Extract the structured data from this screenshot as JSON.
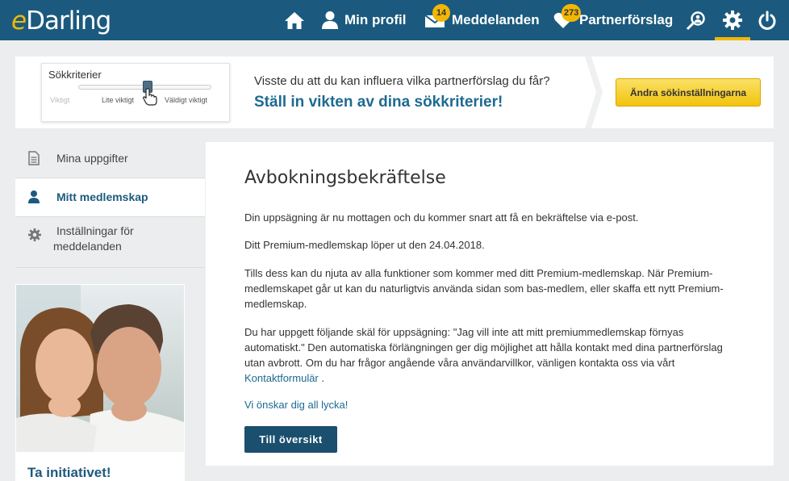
{
  "header": {
    "logo_e": "e",
    "logo_rest": "Darling",
    "nav": {
      "home": "Hem",
      "profile": "Min profil",
      "messages": "Meddelanden",
      "messages_badge": "14",
      "partners": "Partnerförslag",
      "partners_badge": "273"
    }
  },
  "criteria": {
    "title": "Sökkriterier",
    "label_low": "Viktigt",
    "label_mid": "Lite viktigt",
    "label_high": "Väldigt viktigt",
    "question": "Visste du att du kan influera vilka partnerförslag du får?",
    "cta": "Ställ in vikten av dina sökkriterier!",
    "button": "Ändra sökinställningarna"
  },
  "sidebar": {
    "items": [
      {
        "label": "Mina uppgifter"
      },
      {
        "label": "Mitt medlemskap"
      },
      {
        "label_line1": "Inställningar för",
        "label_line2": "meddelanden"
      }
    ],
    "promo_title": "Ta initiativet!"
  },
  "main": {
    "title": "Avbokningsbekräftelse",
    "p1": "Din uppsägning är nu mottagen och du kommer snart att få en bekräftelse via e-post.",
    "p2": "Ditt Premium-medlemskap löper ut den 24.04.2018.",
    "p3": "Tills dess kan du njuta av alla funktioner som kommer med ditt Premium-medlemskap. När Premium-medlemskapet går ut kan du naturligtvis använda sidan som bas-medlem, eller skaffa ett nytt Premium-medlemskap.",
    "p4_text": "Du har uppgett följande skäl för uppsägning: \"Jag vill inte att mitt premiummedlemskap förnyas automatiskt.\" Den automatiska förlängningen ger dig möjlighet att hålla kontakt med dina partnerförslag utan avbrott. Om du har frågor angående våra användarvillkor, vänligen kontakta oss via vårt ",
    "p4_link": "Kontaktformulär",
    "p4_end": " .",
    "farewell": "Vi önskar dig all lycka!",
    "button": "Till översikt"
  },
  "colors": {
    "header_bg": "#1b5a7e",
    "accent_yellow": "#f2b705",
    "link_blue": "#1d6a92",
    "button_dark": "#1b4f6e"
  }
}
